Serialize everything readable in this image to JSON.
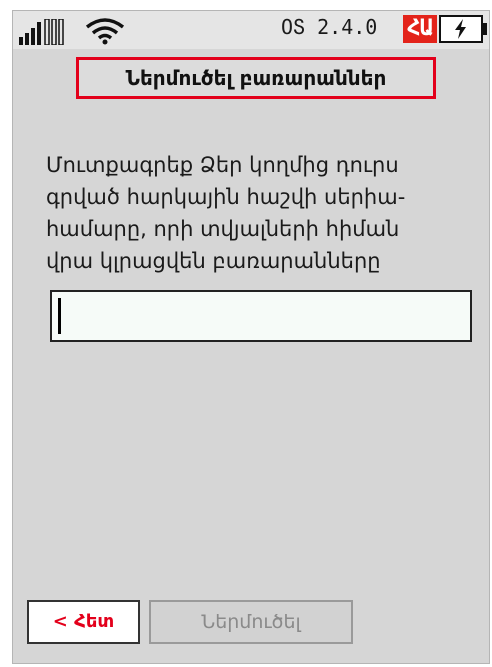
{
  "status_bar": {
    "os_version": "ՕՏ 2.4.0",
    "language_badge": "ՀԱ",
    "icons": [
      "signal-icon",
      "wifi-icon",
      "battery-charging-icon"
    ]
  },
  "header": {
    "title": "Ներմուծել բառարաններ"
  },
  "main": {
    "instructions": "Մուտքագրեք Ձեր կողմից դուրս\nգրված հարկային հաշվի սերիա-\nհամարը, որի տվյալների հիման\nվրա կլրացվեն բառարանները",
    "serial_input": {
      "value": "",
      "placeholder": ""
    }
  },
  "footer": {
    "back_label": "< Հետ",
    "submit_label": "Ներմուծել"
  },
  "colors": {
    "accent_red": "#e3001b",
    "screen_bg": "#d6d6d6",
    "input_bg": "#f6fbf8",
    "disabled_text": "#8a8a8a"
  }
}
